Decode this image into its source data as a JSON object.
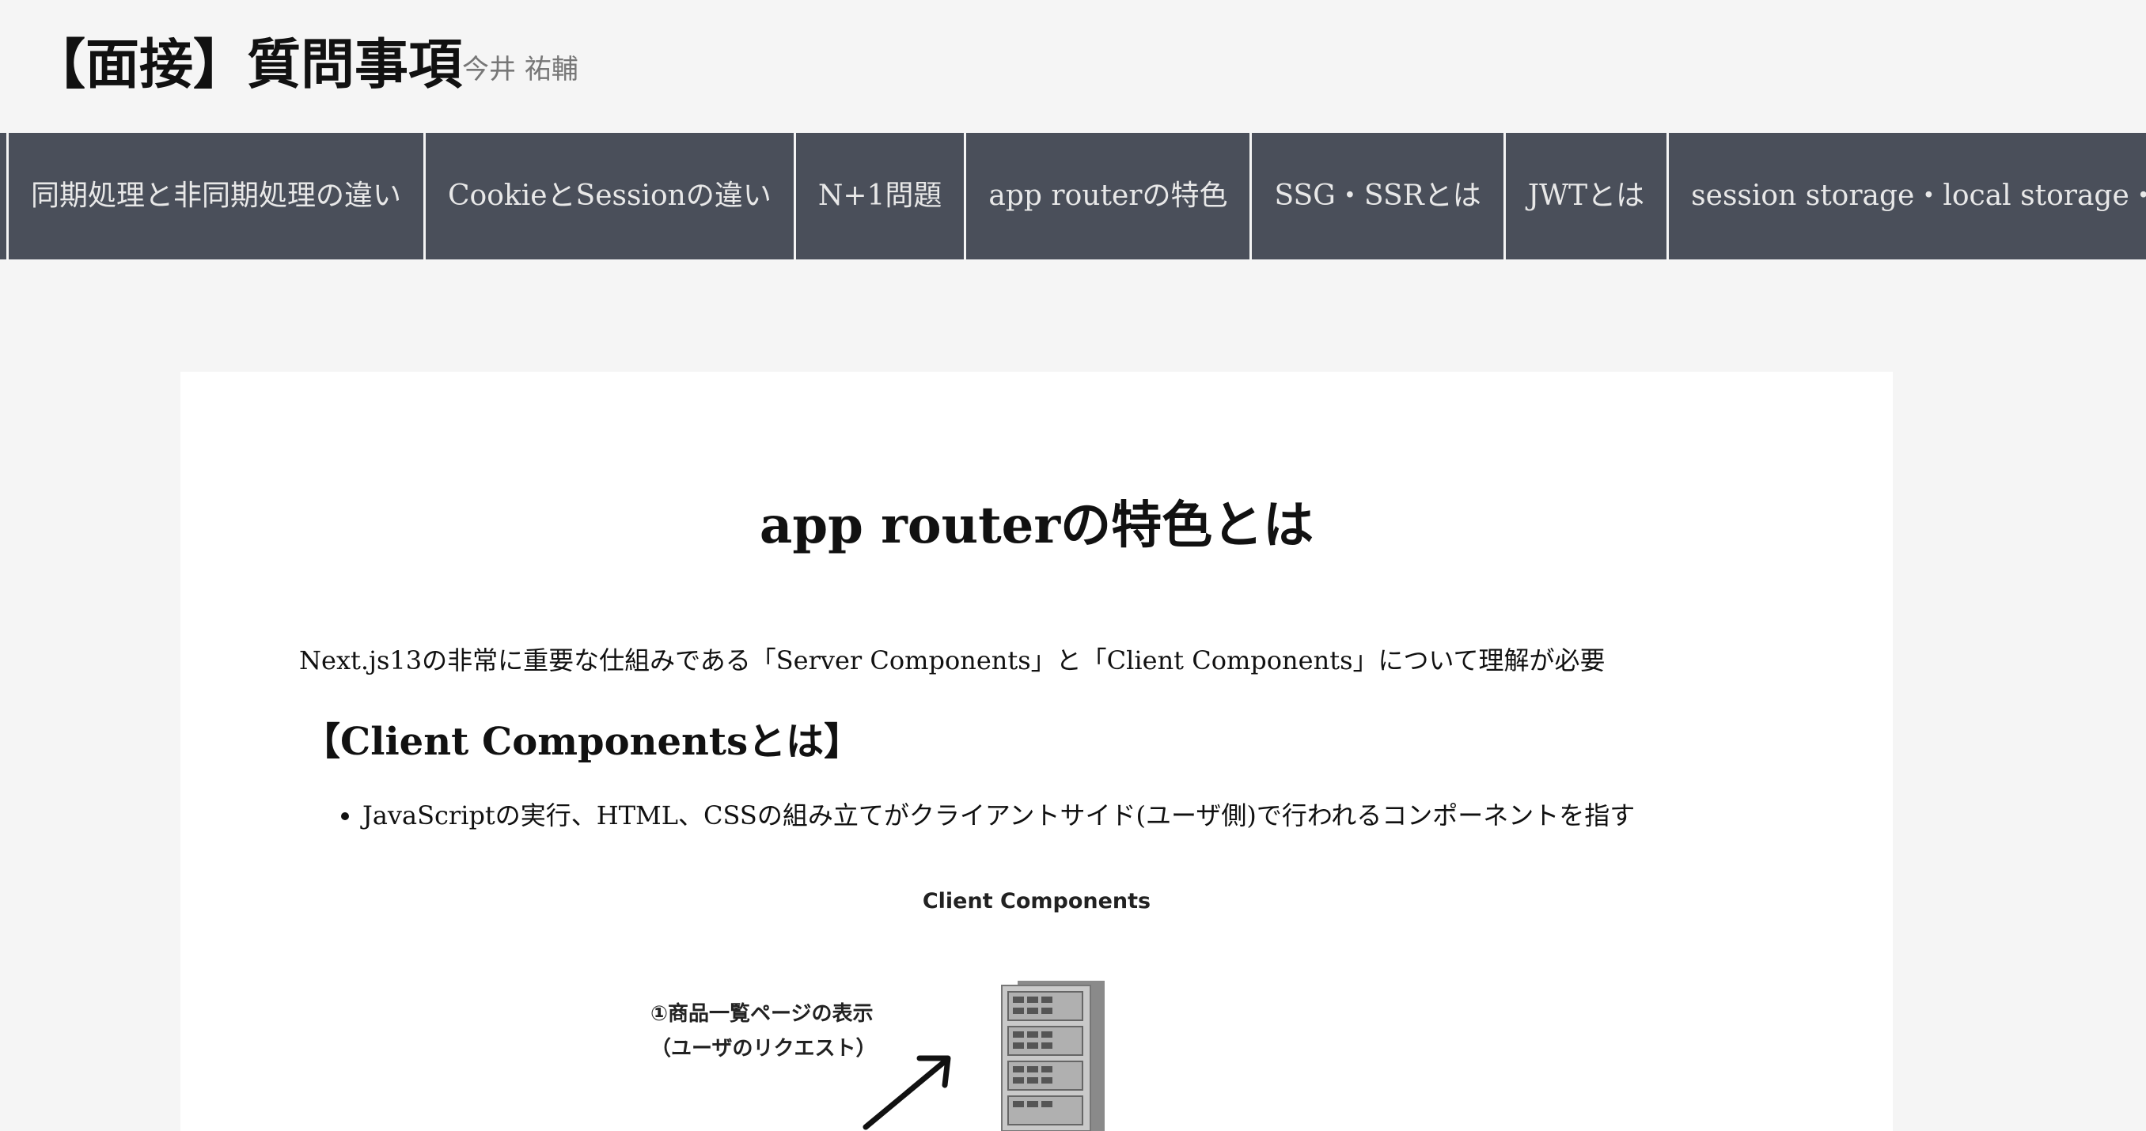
{
  "header": {
    "title": "【面接】質問事項",
    "author": "今井 祐輔"
  },
  "nav": {
    "items": [
      {
        "label": "同期処理と非同期処理の違い"
      },
      {
        "label": "CookieとSessionの違い"
      },
      {
        "label": "N+1問題"
      },
      {
        "label": "app routerの特色"
      },
      {
        "label": "SSG・SSRとは"
      },
      {
        "label": "JWTとは"
      },
      {
        "label": "session storage・local storage・Cookieの違い"
      }
    ]
  },
  "article": {
    "title": "app routerの特色とは",
    "lead": "Next.js13の非常に重要な仕組みである「Server Components」と「Client Components」について理解が必要",
    "section_heading": "【Client Componentsとは】",
    "bullets": [
      "JavaScriptの実行、HTML、CSSの組み立てがクライアントサイド(ユーザ側)で行われるコンポーネントを指す"
    ],
    "diagram": {
      "title": "Client Components",
      "step_line1": "①商品一覧ページの表示",
      "step_line2": "（ユーザのリクエスト）",
      "server_icon": "server-rack-icon",
      "arrow_icon": "arrow-up-right-icon"
    }
  },
  "colors": {
    "page_background": "#f5f5f5",
    "nav_background": "#4a4f5a",
    "nav_text": "#e8e8e8",
    "card_background": "#ffffff",
    "author_text": "#777777"
  }
}
